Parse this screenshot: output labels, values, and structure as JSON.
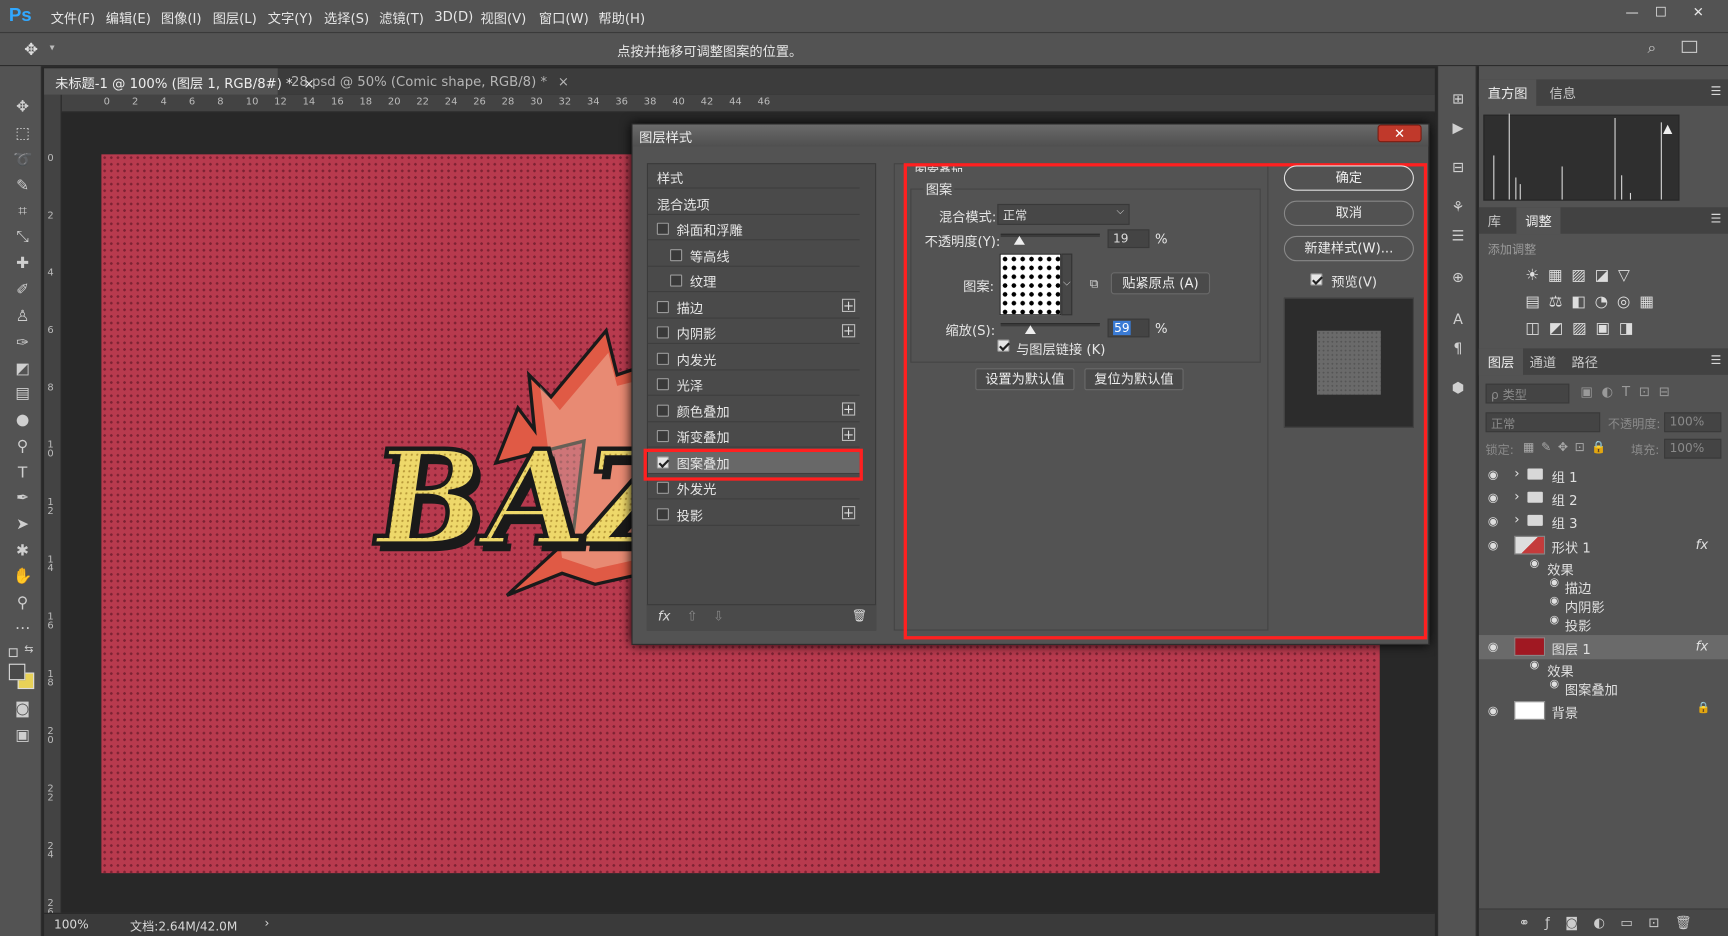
{
  "app": {
    "logo": "Ps",
    "menu": [
      "文件(F)",
      "编辑(E)",
      "图像(I)",
      "图层(L)",
      "文字(Y)",
      "选择(S)",
      "滤镜(T)",
      "3D(D)",
      "视图(V)",
      "窗口(W)",
      "帮助(H)"
    ],
    "window_controls": [
      "—",
      "☐",
      "✕"
    ]
  },
  "options_bar": {
    "hint": "点按并拖移可调整图案的位置。"
  },
  "tabs": [
    {
      "label": "未标题-1 @ 100% (图层 1, RGB/8#) *",
      "close": "×",
      "active": true
    },
    {
      "label": "28.psd @ 50% (Comic shape, RGB/8) *",
      "close": "×",
      "active": false
    }
  ],
  "ruler": {
    "h_ticks": [
      "0",
      "2",
      "4",
      "6",
      "8",
      "10",
      "12",
      "14",
      "16",
      "18",
      "20",
      "22",
      "24",
      "26",
      "28",
      "30",
      "32",
      "34",
      "36",
      "38",
      "40",
      "42",
      "44",
      "46"
    ],
    "v_ticks": [
      "0",
      "2",
      "4",
      "6",
      "8",
      "1 0",
      "1 2",
      "1 4",
      "1 6",
      "1 8",
      "2 0",
      "2 2",
      "2 4",
      "2 6"
    ]
  },
  "canvas": {
    "comic_text": "BAZ"
  },
  "status": {
    "zoom": "100%",
    "doc": "文档:2.64M/42.0M",
    "arrow": "›"
  },
  "dialog": {
    "title": "图层样式",
    "close": "✕",
    "style_list": [
      {
        "label": "样式",
        "checkbox": false,
        "checked": false,
        "plus": false,
        "indent": false
      },
      {
        "label": "混合选项",
        "checkbox": false,
        "checked": false,
        "plus": false,
        "indent": false
      },
      {
        "label": "斜面和浮雕",
        "checkbox": true,
        "checked": false,
        "plus": false,
        "indent": false
      },
      {
        "label": "等高线",
        "checkbox": true,
        "checked": false,
        "plus": false,
        "indent": true
      },
      {
        "label": "纹理",
        "checkbox": true,
        "checked": false,
        "plus": false,
        "indent": true
      },
      {
        "label": "描边",
        "checkbox": true,
        "checked": false,
        "plus": true,
        "indent": false
      },
      {
        "label": "内阴影",
        "checkbox": true,
        "checked": false,
        "plus": true,
        "indent": false
      },
      {
        "label": "内发光",
        "checkbox": true,
        "checked": false,
        "plus": false,
        "indent": false
      },
      {
        "label": "光泽",
        "checkbox": true,
        "checked": false,
        "plus": false,
        "indent": false
      },
      {
        "label": "颜色叠加",
        "checkbox": true,
        "checked": false,
        "plus": true,
        "indent": false
      },
      {
        "label": "渐变叠加",
        "checkbox": true,
        "checked": false,
        "plus": true,
        "indent": false
      },
      {
        "label": "图案叠加",
        "checkbox": true,
        "checked": true,
        "plus": false,
        "indent": false
      },
      {
        "label": "外发光",
        "checkbox": true,
        "checked": false,
        "plus": false,
        "indent": false
      },
      {
        "label": "投影",
        "checkbox": true,
        "checked": false,
        "plus": true,
        "indent": false
      }
    ],
    "list_footer": {
      "fx": "fx",
      "up": "⇧",
      "down": "⇩",
      "trash": "🗑"
    },
    "section_title": "图案叠加",
    "group_title": "图案",
    "blend_label": "混合模式:",
    "blend_value": "正常",
    "opacity_label": "不透明度(Y):",
    "opacity_value": "19",
    "opacity_unit": "%",
    "opacity_fraction": 0.19,
    "pattern_label": "图案:",
    "snap_button": "贴紧原点 (A)",
    "scale_label": "缩放(S):",
    "scale_value": "59",
    "scale_unit": "%",
    "scale_fraction": 0.59,
    "link_label": "与图层链接 (K)",
    "link_checked": true,
    "set_default": "设置为默认值",
    "reset_default": "复位为默认值",
    "ok": "确定",
    "cancel": "取消",
    "new_style": "新建样式(W)...",
    "preview_label": "预览(V)",
    "preview_checked": true
  },
  "panels": {
    "top_tabs": [
      "直方图",
      "信息"
    ],
    "mid_tabs": [
      "库",
      "调整"
    ],
    "add_adjust": "添加调整",
    "layer_tabs": [
      "图层",
      "通道",
      "路径"
    ],
    "filter_label": "ρ 类型",
    "blend_mode": "正常",
    "opacity_label": "不透明度:",
    "opacity_value": "100%",
    "lock_label": "锁定:",
    "fill_label": "填充:",
    "fill_value": "100%",
    "layers": [
      {
        "name": "组 1",
        "kind": "group",
        "fx": false
      },
      {
        "name": "组 2",
        "kind": "group",
        "fx": false
      },
      {
        "name": "组 3",
        "kind": "group",
        "fx": false
      },
      {
        "name": "形状 1",
        "kind": "shape",
        "fx": true
      },
      {
        "name": "效果",
        "kind": "effect-head",
        "fx": false
      },
      {
        "name": "描边",
        "kind": "effect",
        "fx": false
      },
      {
        "name": "内阴影",
        "kind": "effect",
        "fx": false
      },
      {
        "name": "投影",
        "kind": "effect",
        "fx": false
      },
      {
        "name": "图层 1",
        "kind": "fill-red",
        "fx": true
      },
      {
        "name": "效果",
        "kind": "effect-head",
        "fx": false
      },
      {
        "name": "图案叠加",
        "kind": "effect",
        "fx": false
      },
      {
        "name": "背景",
        "kind": "background",
        "fx": false
      }
    ],
    "fx_badge": "fx"
  },
  "colors": {
    "accent_red": "#ff2020",
    "canvas_red": "#b83a4e",
    "layer1_swatch": "#a01822",
    "ps_blue": "#31a8ff"
  }
}
